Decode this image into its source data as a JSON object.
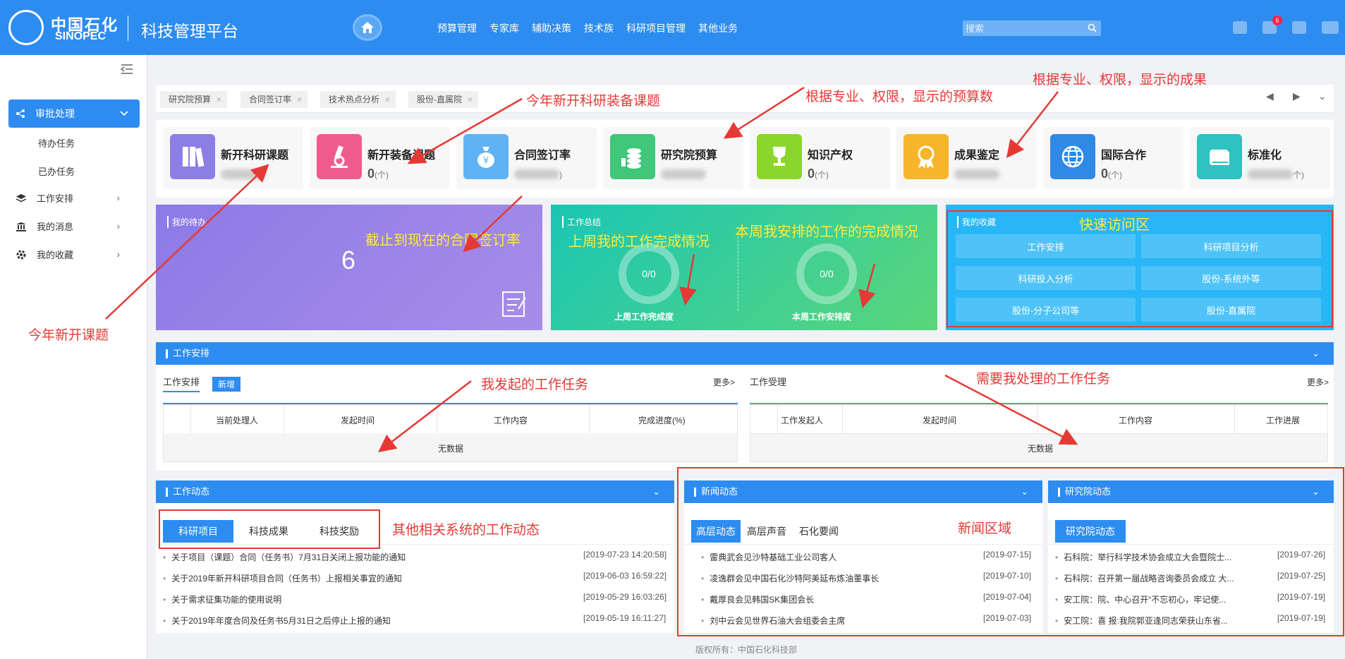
{
  "header": {
    "logo_cn": "中国石化",
    "logo_en": "SINOPEC",
    "app_title": "科技管理平台",
    "nav": [
      "预算管理",
      "专家库",
      "辅助决策",
      "技术族",
      "科研项目管理",
      "其他业务"
    ],
    "search_placeholder": "搜索",
    "notification_count": "6"
  },
  "sidebar": {
    "active": "审批处理",
    "sub": [
      "待办任务",
      "已办任务"
    ],
    "items": [
      "工作安排",
      "我的消息",
      "我的收藏"
    ]
  },
  "tabs": [
    "研究院预算",
    "合同签订率",
    "技术热点分析",
    "股份-直属院"
  ],
  "cards": [
    {
      "title": "新开科研课题",
      "value": "",
      "unit": ""
    },
    {
      "title": "新开装备课题",
      "value": "0",
      "unit": "(个)"
    },
    {
      "title": "合同签订率",
      "value": "",
      "unit": ")"
    },
    {
      "title": "研究院预算",
      "value": "",
      "unit": ""
    },
    {
      "title": "知识产权",
      "value": "0",
      "unit": "(个)"
    },
    {
      "title": "成果鉴定",
      "value": "",
      "unit": ""
    },
    {
      "title": "国际合作",
      "value": "0",
      "unit": "(个)"
    },
    {
      "title": "标准化",
      "value": "",
      "unit": "个)"
    }
  ],
  "todo": {
    "title": "我的待办",
    "count": "6"
  },
  "summary": {
    "title": "工作总结",
    "last_week": {
      "value": "0/0",
      "label": "上周工作完成度"
    },
    "this_week": {
      "value": "0/0",
      "label": "本周工作安排度"
    }
  },
  "favorites": {
    "title": "我的收藏",
    "items": [
      "工作安排",
      "科研项目分析",
      "科研投入分析",
      "股份-系统外等",
      "股份-分子公司等",
      "股份-直属院"
    ]
  },
  "work_plan": {
    "title": "工作安排",
    "left_tab": "工作安排",
    "new_btn": "新增",
    "more": "更多>",
    "left_cols": [
      "当前处理人",
      "发起时间",
      "工作内容",
      "完成进度(%)"
    ],
    "right_tab": "工作受理",
    "right_cols": [
      "工作发起人",
      "发起时间",
      "工作内容",
      "工作进展"
    ],
    "no_data": "无数据"
  },
  "work_news": {
    "title": "工作动态",
    "tabs": [
      "科研项目",
      "科技成果",
      "科技奖励"
    ],
    "items": [
      {
        "text": "关于项目（课题）合同（任务书）7月31日关闭上报功能的通知",
        "date": "[2019-07-23 14:20:58]"
      },
      {
        "text": "关于2019年新开科研项目合同（任务书）上报相关事宜的通知",
        "date": "[2019-06-03 16:59:22]"
      },
      {
        "text": "关于需求征集功能的使用说明",
        "date": "[2019-05-29 16:03:26]"
      },
      {
        "text": "关于2019年年度合同及任务书5月31日之后停止上报的通知",
        "date": "[2019-05-19 16:11:27]"
      }
    ]
  },
  "news": {
    "title": "新闻动态",
    "tabs": [
      "高层动态",
      "高层声音",
      "石化要闻"
    ],
    "items": [
      {
        "text": "雷典武会见沙特基础工业公司客人",
        "date": "[2019-07-15]"
      },
      {
        "text": "凌逸群会见中国石化沙特阿美延布炼油董事长",
        "date": "[2019-07-10]"
      },
      {
        "text": "戴厚良会见韩国SK集团会长",
        "date": "[2019-07-04]"
      },
      {
        "text": "刘中云会见世界石油大会组委会主席",
        "date": "[2019-07-03]"
      }
    ]
  },
  "institute": {
    "title": "研究院动态",
    "tabs": [
      "研究院动态"
    ],
    "items": [
      {
        "text": "石科院：举行科学技术协会成立大会暨院士...",
        "date": "[2019-07-26]"
      },
      {
        "text": "石科院：召开第一届战略咨询委员会成立 大...",
        "date": "[2019-07-25]"
      },
      {
        "text": "安工院：院、中心召开“不忘初心，牢记使...",
        "date": "[2019-07-19]"
      },
      {
        "text": "安工院：喜 报:我院郭亚逢同志荣获山东省...",
        "date": "[2019-07-19]"
      }
    ]
  },
  "footer": "版权所有：中国石化科技部",
  "annotations": {
    "new_equipment": "今年新开科研装备课题",
    "budget": "根据专业、权限，显示的预算数",
    "results": "根据专业、权限，显示的成果",
    "new_topics": "今年新开课题",
    "contract_rate": "截止到现在的合同签订率",
    "last_week": "上周我的工作完成情况",
    "this_week": "本周我安排的工作的完成情况",
    "quick_access": "快速访问区",
    "my_tasks": "我发起的工作任务",
    "todo_tasks": "需要我处理的工作任务",
    "other_systems": "其他相关系统的工作动态",
    "news_area": "新闻区域"
  }
}
